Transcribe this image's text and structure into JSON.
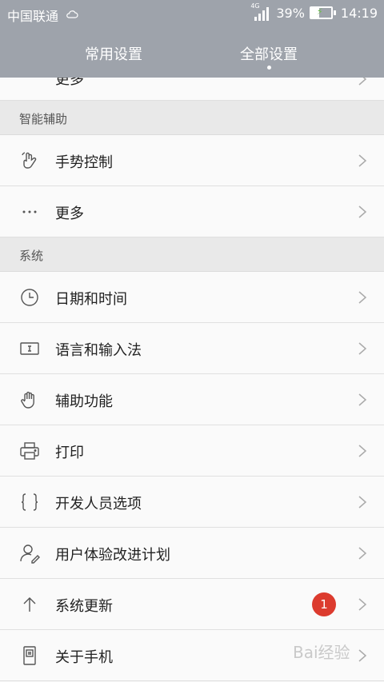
{
  "status_bar": {
    "carrier": "中国联通",
    "network": "4G",
    "battery_text": "39%",
    "battery_level": 0.39,
    "time": "14:19"
  },
  "tabs": [
    {
      "label": "常用设置",
      "active": false
    },
    {
      "label": "全部设置",
      "active": true
    }
  ],
  "partial_row_label": "更多",
  "sections": [
    {
      "title": "智能辅助",
      "items": [
        {
          "label": "手势控制",
          "icon": "gesture-hand-icon"
        },
        {
          "label": "更多",
          "icon": "more-dots-icon"
        }
      ]
    },
    {
      "title": "系统",
      "items": [
        {
          "label": "日期和时间",
          "icon": "clock-icon"
        },
        {
          "label": "语言和输入法",
          "icon": "keyboard-icon"
        },
        {
          "label": "辅助功能",
          "icon": "hand-icon"
        },
        {
          "label": "打印",
          "icon": "printer-icon"
        },
        {
          "label": "开发人员选项",
          "icon": "braces-icon"
        },
        {
          "label": "用户体验改进计划",
          "icon": "user-edit-icon"
        },
        {
          "label": "系统更新",
          "icon": "arrow-up-icon",
          "badge": "1"
        },
        {
          "label": "关于手机",
          "icon": "phone-icon"
        }
      ]
    }
  ],
  "watermark": "Bai经验",
  "colors": {
    "header_bg": "#9ea3ab",
    "badge": "#dc3b2e",
    "battery_bolt": "#6cc04a"
  }
}
